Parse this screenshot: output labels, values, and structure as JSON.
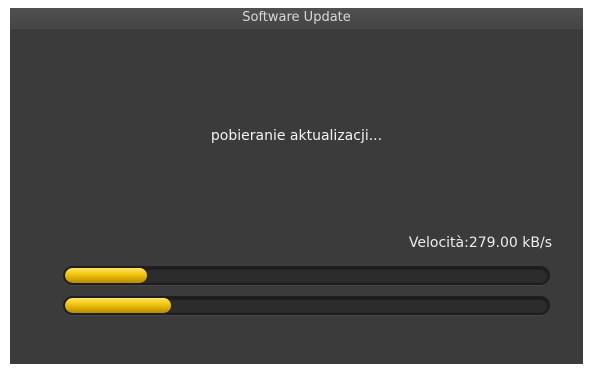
{
  "window": {
    "title": "Software Update"
  },
  "status": {
    "message": "pobieranie aktualizacji..."
  },
  "speed": {
    "text": "Velocità:279.00 kB/s"
  },
  "progress_bars": [
    {
      "name": "progress-bar-primary",
      "value_percent": 17
    },
    {
      "name": "progress-bar-secondary",
      "value_percent": 22
    }
  ],
  "colors": {
    "panel_background": "#3b3b3b",
    "title_bar": "#4b4b4b",
    "progress_fill": "#e8bb00",
    "progress_track": "#2c2c2c"
  }
}
